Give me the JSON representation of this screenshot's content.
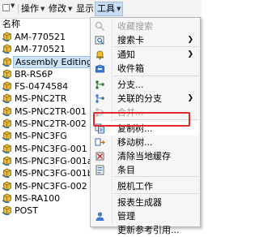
{
  "toolbar": {
    "menus": [
      {
        "label": "操作",
        "active": false
      },
      {
        "label": "修改",
        "active": false
      },
      {
        "label": "显示",
        "active": false
      },
      {
        "label": "工具",
        "active": true
      }
    ],
    "caret": "▼"
  },
  "list": {
    "column_header": "名称",
    "items": [
      {
        "name": "AM-770521",
        "icon": "part-icon",
        "selected": false
      },
      {
        "name": "AM-770521",
        "icon": "part-icon",
        "selected": false
      },
      {
        "name": "Assembly Editing",
        "icon": "part-icon",
        "selected": true
      },
      {
        "name": "BR-RS6P",
        "icon": "part-icon",
        "selected": false
      },
      {
        "name": "FS-0474584",
        "icon": "part-icon",
        "selected": false
      },
      {
        "name": "MS-PNC2TR",
        "icon": "part-icon",
        "selected": false
      },
      {
        "name": "MS-PNC2TR-001",
        "icon": "part-icon",
        "selected": false
      },
      {
        "name": "MS-PNC2TR-002",
        "icon": "part-icon",
        "selected": false
      },
      {
        "name": "MS-PNC3FG",
        "icon": "part-icon",
        "selected": false
      },
      {
        "name": "MS-PNC3FG-001",
        "icon": "part-icon",
        "selected": false
      },
      {
        "name": "MS-PNC3FG-001a",
        "icon": "part-icon",
        "selected": false
      },
      {
        "name": "MS-PNC3FG-001b",
        "icon": "part-icon",
        "selected": false
      },
      {
        "name": "MS-PNC3FG-002",
        "icon": "part-icon",
        "selected": false
      },
      {
        "name": "MS-RA100",
        "icon": "part-icon",
        "selected": false
      },
      {
        "name": "POST",
        "icon": "part-icon",
        "selected": false
      }
    ]
  },
  "tools_menu": {
    "items": [
      {
        "label": "收藏搜索",
        "icon": "favorite-search-icon",
        "disabled": true,
        "submenu": false
      },
      {
        "label": "搜索卡",
        "icon": "search-card-icon",
        "disabled": false,
        "submenu": true
      },
      {
        "label": "通知",
        "icon": "notification-icon",
        "disabled": false,
        "submenu": true
      },
      {
        "label": "收件箱",
        "icon": "inbox-icon",
        "disabled": false,
        "submenu": false
      },
      {
        "label": "分支...",
        "icon": "branch-icon",
        "disabled": false,
        "submenu": false
      },
      {
        "label": "关联的分支",
        "icon": "related-branch-icon",
        "disabled": false,
        "submenu": true
      },
      {
        "label": "合并...",
        "icon": "merge-icon",
        "disabled": true,
        "submenu": false
      },
      {
        "label": "复制树...",
        "icon": "copy-tree-icon",
        "disabled": false,
        "submenu": false,
        "highlighted": true
      },
      {
        "label": "移动树...",
        "icon": "move-tree-icon",
        "disabled": false,
        "submenu": false
      },
      {
        "label": "清除当地缓存",
        "icon": "clear-cache-icon",
        "disabled": false,
        "submenu": false
      },
      {
        "label": "条目",
        "icon": "entry-icon",
        "disabled": false,
        "submenu": false
      },
      {
        "label": "脱机工作",
        "icon": "",
        "disabled": false,
        "submenu": false
      },
      {
        "label": "报表生成器",
        "icon": "",
        "disabled": false,
        "submenu": false
      },
      {
        "label": "管理",
        "icon": "admin-icon",
        "disabled": false,
        "submenu": false
      },
      {
        "label": "更新参考引用...",
        "icon": "",
        "disabled": false,
        "submenu": false
      }
    ],
    "submenu_arrow": "❯"
  },
  "colors": {
    "accent_highlight": "#e02828",
    "selection": "#cce3f7",
    "toolbar_bg": "#f3f3f3",
    "menu_bg": "#f6f6f6"
  }
}
